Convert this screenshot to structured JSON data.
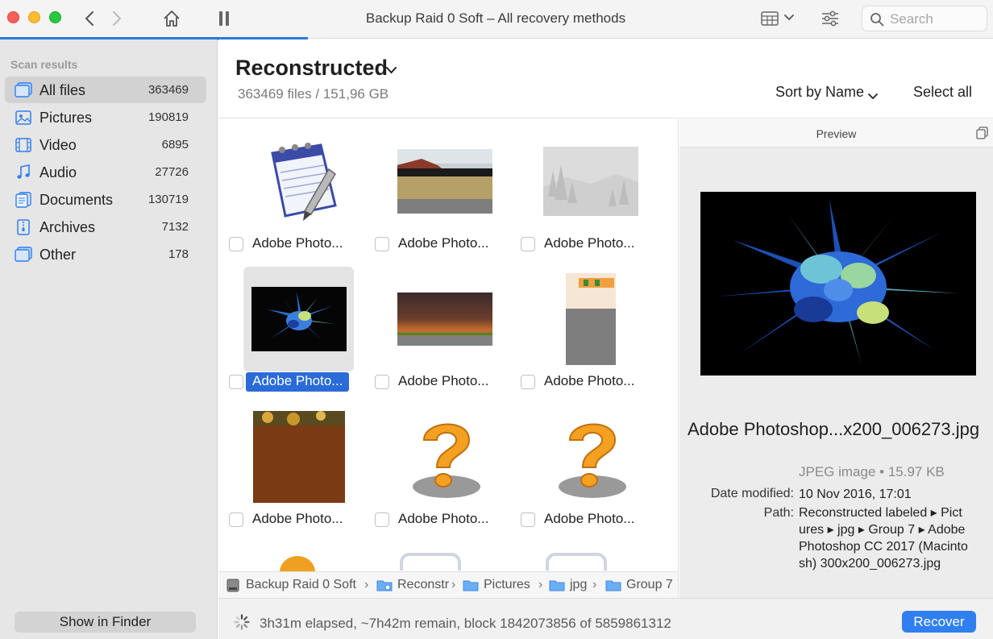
{
  "window": {
    "title": "Backup Raid 0 Soft – All recovery methods",
    "scan_progress_fraction": 0.31,
    "search_placeholder": "Search"
  },
  "toolbar": {
    "icons": [
      "chevron-left-icon",
      "chevron-right-icon",
      "home-icon",
      "pause-icon",
      "view-grid-icon",
      "chevron-down-icon",
      "filter-sliders-icon",
      "search-icon"
    ]
  },
  "sidebar": {
    "heading": "Scan results",
    "items": [
      {
        "label": "All files",
        "count": "363469",
        "icon": "all-files-icon",
        "active": true
      },
      {
        "label": "Pictures",
        "count": "190819",
        "icon": "pictures-icon",
        "active": false
      },
      {
        "label": "Video",
        "count": "6895",
        "icon": "video-icon",
        "active": false
      },
      {
        "label": "Audio",
        "count": "27726",
        "icon": "audio-icon",
        "active": false
      },
      {
        "label": "Documents",
        "count": "130719",
        "icon": "documents-icon",
        "active": false
      },
      {
        "label": "Archives",
        "count": "7132",
        "icon": "archives-icon",
        "active": false
      },
      {
        "label": "Other",
        "count": "178",
        "icon": "other-icon",
        "active": false
      }
    ],
    "show_in_finder": "Show in Finder"
  },
  "content": {
    "folder_title": "Reconstructed",
    "summary": "363469 files / 151,96 GB",
    "sort_label": "Sort by Name",
    "select_all": "Select all"
  },
  "grid": {
    "files": [
      {
        "label": "Adobe Photo...",
        "thumb": "notepad"
      },
      {
        "label": "Adobe Photo...",
        "thumb": "landscape"
      },
      {
        "label": "Adobe Photo...",
        "thumb": "trees"
      },
      {
        "label": "Adobe Photo...",
        "thumb": "explosion",
        "selected": true
      },
      {
        "label": "Adobe Photo...",
        "thumb": "sunset"
      },
      {
        "label": "Adobe Photo...",
        "thumb": "partial"
      },
      {
        "label": "Adobe Photo...",
        "thumb": "brown"
      },
      {
        "label": "Adobe Photo...",
        "thumb": "question"
      },
      {
        "label": "Adobe Photo...",
        "thumb": "question"
      }
    ]
  },
  "breadcrumb": {
    "items": [
      "Backup Raid 0 Soft",
      "Reconstr",
      "Pictures",
      "jpg",
      "Group 7"
    ],
    "separator": "›"
  },
  "preview": {
    "title": "Preview",
    "filename": "Adobe Photoshop...x200_006273.jpg",
    "type": "JPEG image • 15.97 KB",
    "date_label": "Date modified:",
    "date_value": "10 Nov 2016, 17:01",
    "path_label": "Path:",
    "path_value": "Reconstructed labeled ▸ Pict ures ▸ jpg ▸ Group 7 ▸ Adobe Photoshop CC 2017 (Macinto sh) 300x200_006273.jpg"
  },
  "status": {
    "text": "3h31m elapsed, ~7h42m remain, block 1842073856 of 5859861312",
    "recover_label": "Recover"
  },
  "colors": {
    "accent": "#2f7ff0",
    "selection": "#2a6bd8",
    "sidebar_bg": "#e6e6e6",
    "preview_bg": "#ececec"
  }
}
